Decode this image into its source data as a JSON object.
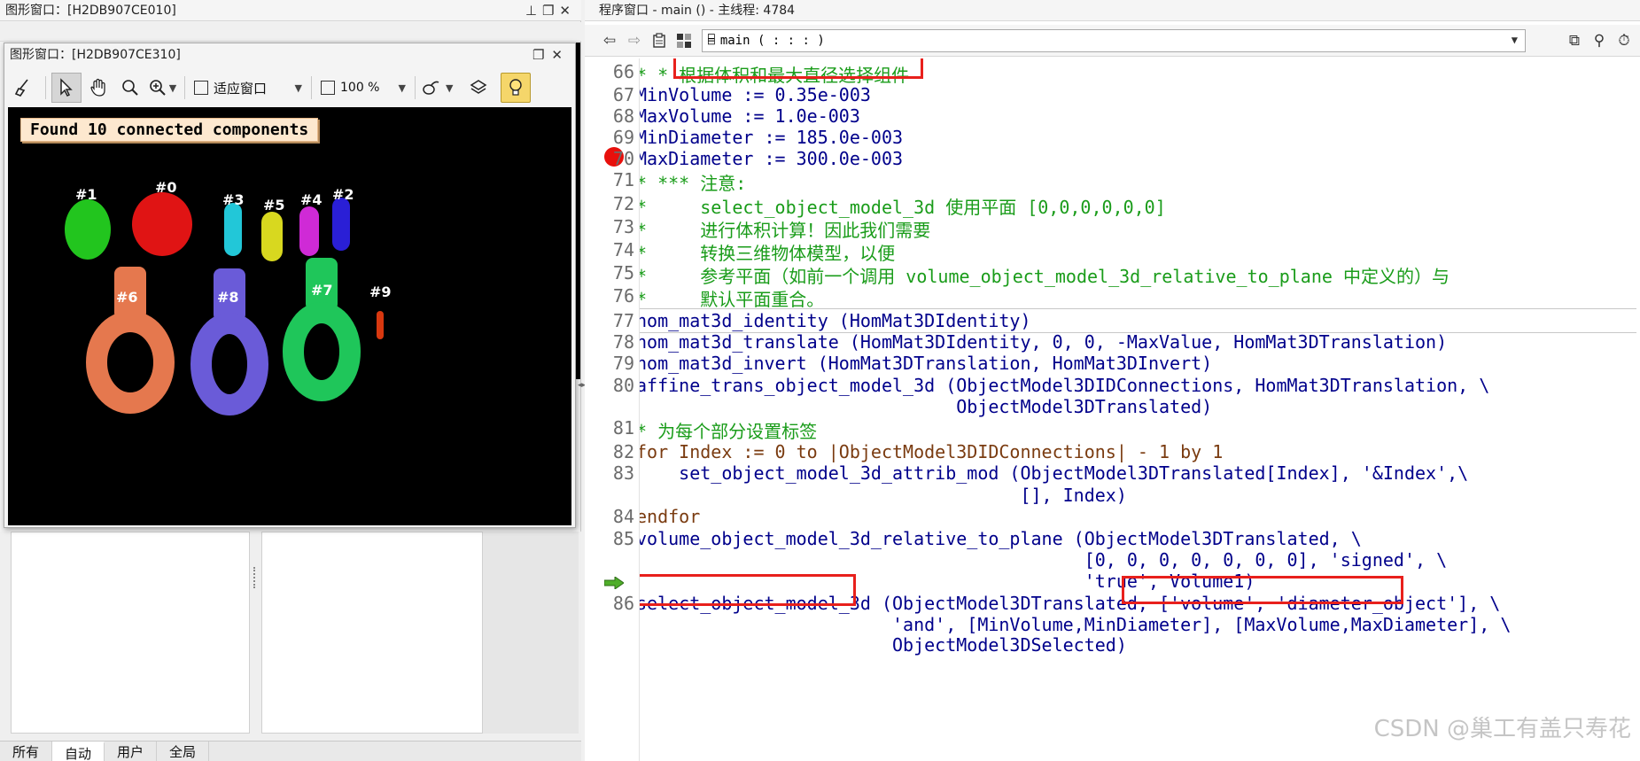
{
  "graphics_window_bg": {
    "title": "图形窗口：[H2DB907CE010]"
  },
  "graphics_window": {
    "title": "图形窗口：[H2DB907CE310]",
    "toolbar": {
      "fit_window_label": "适应窗口",
      "zoom_label": "100 %"
    },
    "canvas": {
      "status_label": "Found 10 connected components",
      "objects": [
        {
          "label": "#0",
          "color": "#e01414"
        },
        {
          "label": "#1",
          "color": "#22c51e"
        },
        {
          "label": "#2",
          "color": "#2a1fd6"
        },
        {
          "label": "#3",
          "color": "#22c7d8"
        },
        {
          "label": "#4",
          "color": "#cf2ad6"
        },
        {
          "label": "#5",
          "color": "#d8d81f"
        },
        {
          "label": "#6",
          "color": "#e5784e"
        },
        {
          "label": "#7",
          "color": "#1fc65a"
        },
        {
          "label": "#8",
          "color": "#6a5bd8"
        },
        {
          "label": "#9",
          "color": "#d8380f"
        }
      ]
    }
  },
  "bottom_tabs": [
    "所有",
    "自动",
    "用户",
    "全局"
  ],
  "program_window": {
    "title": "程序窗口 - main () - 主线程: 4784",
    "procedure_select": "main ( : : : )",
    "watermark": "CSDN @巢工有盖只寿花",
    "breakpoint_color": "#e8100c",
    "highlight_color": "#e8201c",
    "lines": [
      {
        "num": "66",
        "text": "* * 根据体积和最大直径选择组件",
        "kind": "comment"
      },
      {
        "num": "67",
        "text": "MinVolume := 0.35e-003",
        "kind": "op"
      },
      {
        "num": "68",
        "text": "MaxVolume := 1.0e-003",
        "kind": "op"
      },
      {
        "num": "69",
        "text": "MinDiameter := 185.0e-003",
        "kind": "op"
      },
      {
        "num": "70",
        "text": "MaxDiameter := 300.0e-003",
        "kind": "op"
      },
      {
        "num": "71",
        "text": "* *** 注意:",
        "kind": "comment"
      },
      {
        "num": "72",
        "text": "*     select_object_model_3d 使用平面 [0,0,0,0,0,0]",
        "kind": "comment"
      },
      {
        "num": "73",
        "text": "*     进行体积计算！因此我们需要",
        "kind": "comment"
      },
      {
        "num": "74",
        "text": "*     转换三维物体模型，以便",
        "kind": "comment"
      },
      {
        "num": "75",
        "text": "*     参考平面（如前一个调用 volume_object_model_3d_relative_to_plane 中定义的）与",
        "kind": "comment"
      },
      {
        "num": "76",
        "text": "*     默认平面重合。",
        "kind": "comment"
      },
      {
        "num": "77",
        "text": "hom_mat3d_identity (HomMat3DIdentity)",
        "kind": "op"
      },
      {
        "num": "78",
        "text": "hom_mat3d_translate (HomMat3DIdentity, 0, 0, -MaxValue, HomMat3DTranslation)",
        "kind": "op"
      },
      {
        "num": "79",
        "text": "hom_mat3d_invert (HomMat3DTranslation, HomMat3DInvert)",
        "kind": "op"
      },
      {
        "num": "80",
        "text": "affine_trans_object_model_3d (ObjectModel3DIDConnections, HomMat3DTranslation, \\",
        "kind": "op"
      },
      {
        "num": "",
        "text": "                              ObjectModel3DTranslated)",
        "kind": "op"
      },
      {
        "num": "81",
        "text": "* 为每个部分设置标签",
        "kind": "comment"
      },
      {
        "num": "82",
        "text": "for Index := 0 to |ObjectModel3DIDConnections| - 1 by 1",
        "kind": "kw"
      },
      {
        "num": "83",
        "text": "    set_object_model_3d_attrib_mod (ObjectModel3DTranslated[Index], '&Index',\\",
        "kind": "op"
      },
      {
        "num": "",
        "text": "                                    [], Index)",
        "kind": "op"
      },
      {
        "num": "84",
        "text": "endfor",
        "kind": "kw"
      },
      {
        "num": "85",
        "text": "volume_object_model_3d_relative_to_plane (ObjectModel3DTranslated, \\",
        "kind": "op"
      },
      {
        "num": "",
        "text": "                                          [0, 0, 0, 0, 0, 0, 0], 'signed', \\",
        "kind": "op"
      },
      {
        "num": "",
        "text": "                                          'true', Volume1)",
        "kind": "op"
      },
      {
        "num": "86",
        "text": "select_object_model_3d (ObjectModel3DTranslated, ['volume', 'diameter_object'], \\",
        "kind": "op"
      },
      {
        "num": "",
        "text": "                        'and', [MinVolume,MinDiameter], [MaxVolume,MaxDiameter], \\",
        "kind": "op"
      },
      {
        "num": "",
        "text": "                        ObjectModel3DSelected)",
        "kind": "op"
      }
    ]
  }
}
